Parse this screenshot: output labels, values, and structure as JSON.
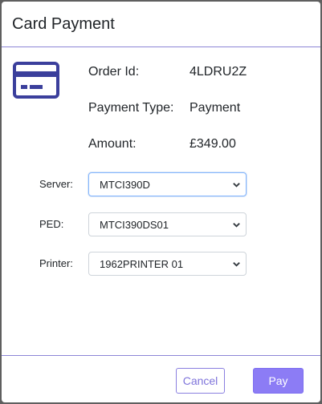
{
  "dialog": {
    "title": "Card Payment"
  },
  "order": {
    "order_id_label": "Order Id:",
    "order_id_value": "4LDRU2Z",
    "payment_type_label": "Payment Type:",
    "payment_type_value": "Payment",
    "amount_label": "Amount:",
    "amount_value": "£349.00"
  },
  "fields": {
    "server_label": "Server:",
    "server_value": "MTCI390D",
    "ped_label": "PED:",
    "ped_value": "MTCI390DS01",
    "printer_label": "Printer:",
    "printer_value": "1962PRINTER 01"
  },
  "footer": {
    "cancel_label": "Cancel",
    "pay_label": "Pay"
  },
  "colors": {
    "accent": "#8c7cf5",
    "card_icon": "#3b3f9c",
    "divider": "#8d86d6"
  },
  "icons": {
    "card": "credit-card-icon",
    "dropdown": "chevron-down-icon"
  }
}
